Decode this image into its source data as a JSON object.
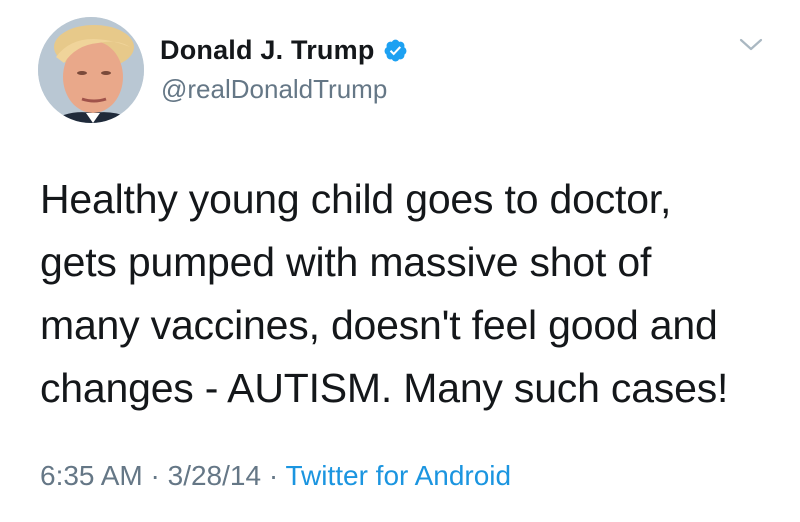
{
  "user": {
    "display_name": "Donald J. Trump",
    "handle": "@realDonaldTrump",
    "verified_icon": "verified-badge-icon",
    "avatar": "profile-photo"
  },
  "tweet": {
    "text": "Healthy young child goes to doctor,\ngets pumped with massive shot of\nmany vaccines, doesn't feel good and\nchanges - AUTISM. Many such cases!"
  },
  "meta": {
    "time": "6:35 AM",
    "separator_1": " · ",
    "date": "3/28/14",
    "separator_2": " · ",
    "source": "Twitter for Android"
  },
  "menu_icon": "chevron-down-icon",
  "colors": {
    "verified_blue": "#1da1f2",
    "secondary_text": "#657786",
    "link_blue": "#1b95e0",
    "primary_text": "#14171a"
  }
}
